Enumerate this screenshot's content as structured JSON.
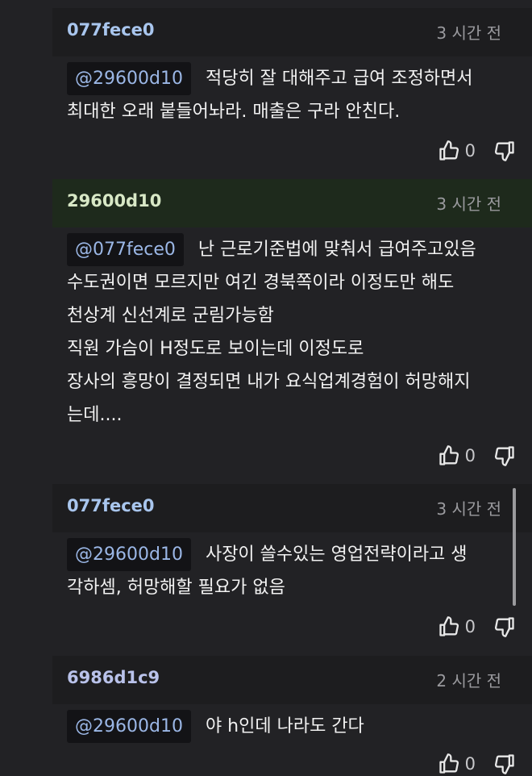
{
  "comments": [
    {
      "author": "077fece0",
      "time": "3 시간 전",
      "mention": "@29600d10",
      "lines": [
        "적당히 잘 대해주고 급여 조정하면서",
        "최대한 오래 붙들어놔라. 매출은 구라 안친다."
      ],
      "likes": "0"
    },
    {
      "author": "29600d10",
      "time": "3 시간 전",
      "mention": "@077fece0",
      "lines": [
        "난 근로기준법에 맞춰서 급여주고있음",
        "수도권이면 모르지만 여긴 경북쪽이라 이정도만 해도",
        "천상계 신선계로 군림가능함",
        "직원 가슴이 H정도로 보이는데 이정도로",
        "장사의 흥망이 결정되면 내가 요식업계경험이 허망해지",
        "는데...."
      ],
      "likes": "0"
    },
    {
      "author": "077fece0",
      "time": "3 시간 전",
      "mention": "@29600d10",
      "lines": [
        "사장이 쓸수있는 영업전략이라고 생",
        "각하셈, 허망해할 필요가 없음"
      ],
      "likes": "0"
    },
    {
      "author": "6986d1c9",
      "time": "2 시간 전",
      "mention": "@29600d10",
      "lines": [
        "야 h인데 나라도 간다"
      ],
      "likes": "0"
    }
  ],
  "icons": {
    "like": "thumbs-up-icon",
    "dislike": "thumbs-down-icon"
  }
}
